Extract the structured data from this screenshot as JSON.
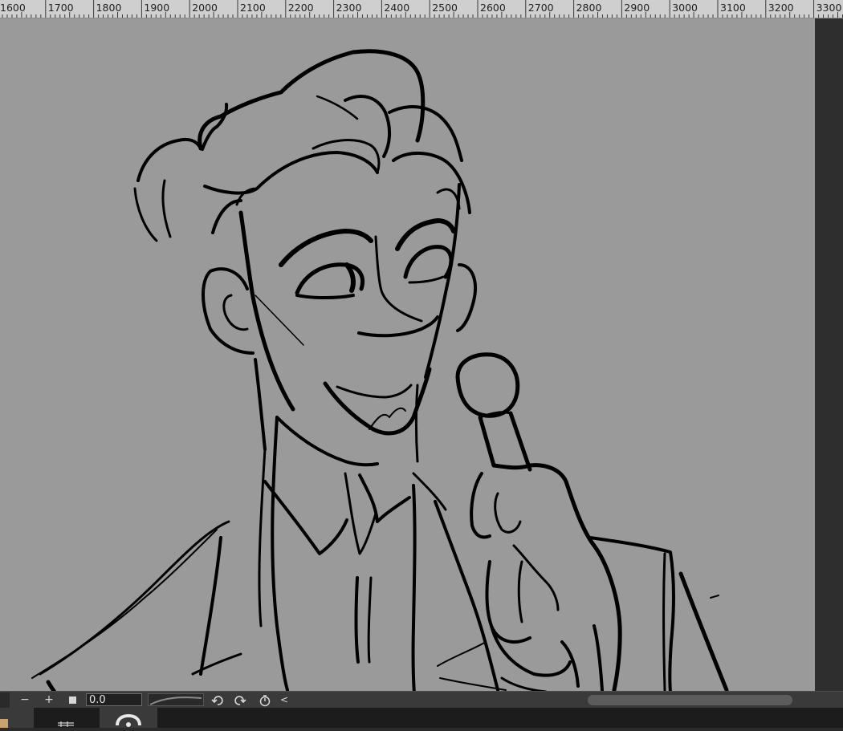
{
  "ruler": {
    "labels": [
      "1600",
      "1700",
      "1800",
      "1900",
      "2000",
      "2100",
      "2200",
      "2300",
      "2400",
      "2500",
      "2600",
      "2700",
      "2800",
      "2900",
      "3000",
      "3100",
      "3200",
      "3300"
    ]
  },
  "bottom_bar": {
    "zoom_out_label": "−",
    "zoom_in_label": "+",
    "zoom_value": "0.0",
    "collapse_label": "<"
  },
  "colors": {
    "canvas": "#9a9a9a",
    "ink": "#000000",
    "ruler_bg": "#cfcfcf",
    "panel_dark": "#2e2e2e"
  },
  "icons": {
    "fit": "square-icon",
    "rotate_left": "undo-rotate-icon",
    "rotate_right": "redo-rotate-icon",
    "reset_rotation": "reset-rotation-icon"
  }
}
